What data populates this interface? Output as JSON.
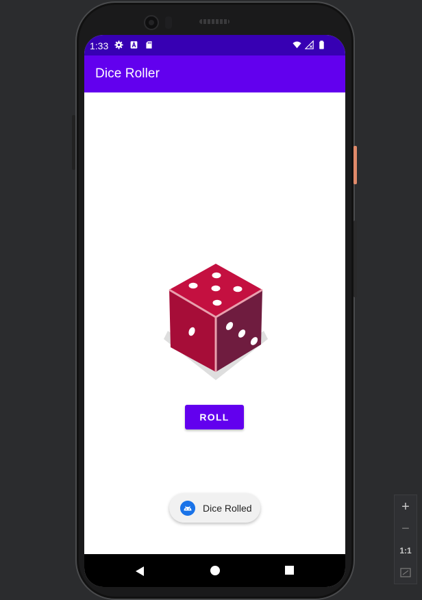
{
  "status_bar": {
    "time": "1:33",
    "icons_left": [
      "settings-icon",
      "a-badge-icon",
      "sd-card-icon"
    ],
    "icons_right": [
      "wifi-icon",
      "signal-icon",
      "battery-icon"
    ]
  },
  "app_bar": {
    "title": "Dice Roller"
  },
  "main": {
    "dice_image": "dice-five",
    "roll_button_label": "ROLL"
  },
  "toast": {
    "message": "Dice Rolled",
    "icon": "android-icon"
  },
  "nav_bar": {
    "items": [
      "back",
      "home",
      "recents"
    ]
  },
  "emulator_zoom": {
    "zoom_in": "+",
    "zoom_out": "−",
    "reset": "1:1"
  },
  "colors": {
    "status_bar": "#3700b3",
    "app_bar": "#6200ee",
    "button": "#6200ee",
    "dice_top": "#c41040",
    "dice_left": "#a60d38",
    "dice_right": "#6f1c3f"
  }
}
